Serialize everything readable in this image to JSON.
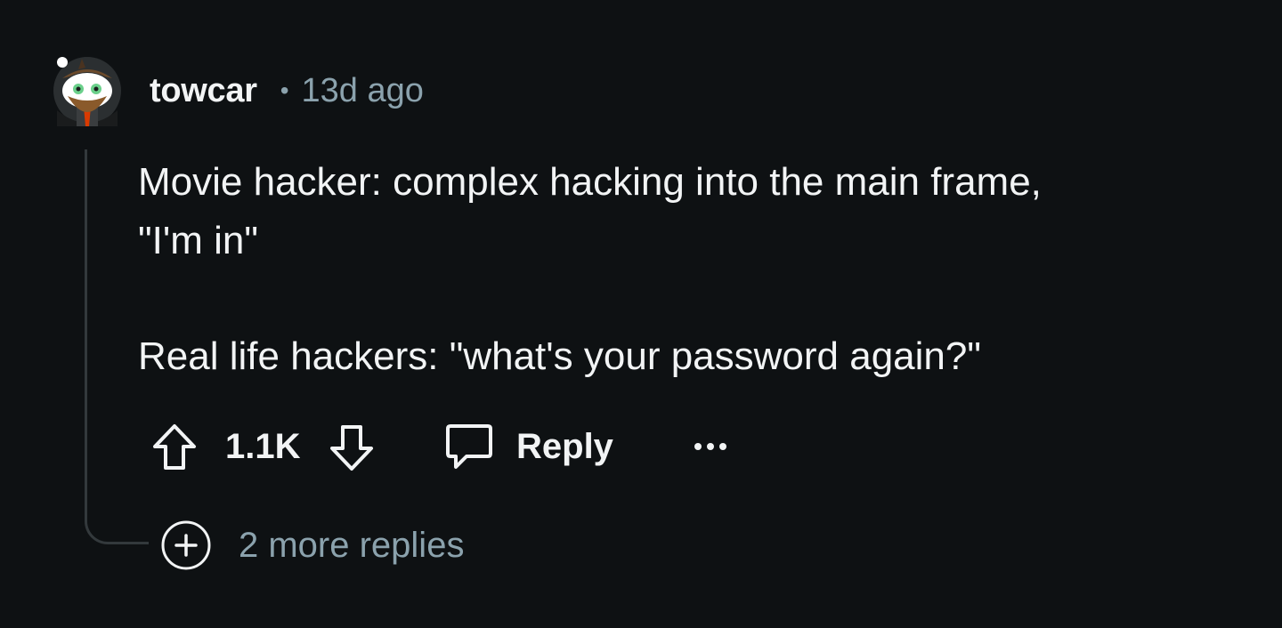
{
  "comment": {
    "username": "towcar",
    "separator": "•",
    "timestamp": "13d ago",
    "body": [
      "Movie hacker: complex hacking into the main frame,\n\"I'm in\"",
      "Real life hackers: \"what's your password again?\""
    ],
    "vote_count": "1.1K",
    "reply_label": "Reply",
    "more_label": "•••",
    "more_replies_label": "2 more replies"
  },
  "icons": {
    "avatar": "snoo-avatar-icon",
    "upvote": "arrow-up-icon",
    "downvote": "arrow-down-icon",
    "reply": "speech-bubble-icon",
    "more": "ellipsis-icon",
    "expand": "plus-circle-icon"
  },
  "colors": {
    "background": "#0e1113",
    "text_primary": "#f2f4f5",
    "text_secondary": "#8ba2ad",
    "thread_line": "#33393c"
  }
}
